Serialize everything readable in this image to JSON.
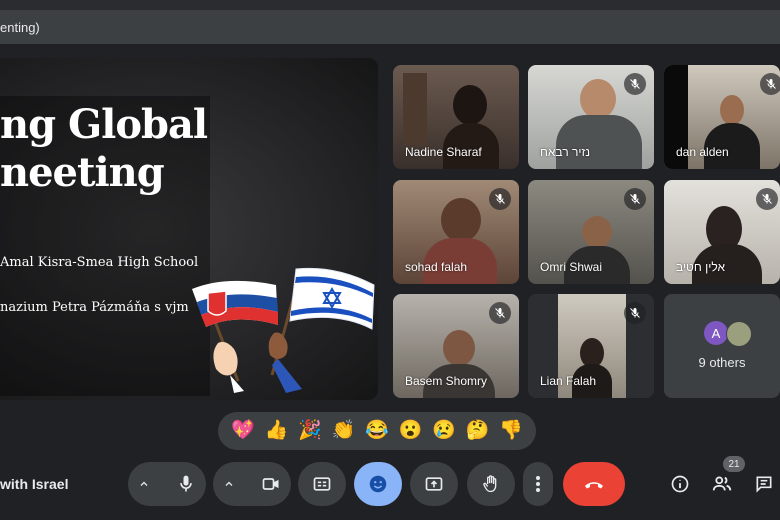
{
  "window": {
    "title": "enting)"
  },
  "presentation": {
    "title_line1": "ng Global",
    "title_line2": "neeting",
    "school1": "Amal Kisra-Smea High School",
    "school2": "nazium Petra Pázmáňa s vjm"
  },
  "tiles": [
    {
      "name": "Nadine Sharaf",
      "muted": false
    },
    {
      "name": "נזיר רבאח",
      "muted": true
    },
    {
      "name": "dan alden",
      "muted": true
    },
    {
      "name": "sohad falah",
      "muted": true
    },
    {
      "name": "Omri Shwai",
      "muted": true
    },
    {
      "name": "אלין חטיב",
      "muted": true
    },
    {
      "name": "Basem Shomry",
      "muted": true
    },
    {
      "name": "Lian Falah",
      "muted": true
    }
  ],
  "others": {
    "avatar_letter": "A",
    "label": "9 others"
  },
  "reactions": [
    "💖",
    "👍",
    "🎉",
    "👏",
    "😂",
    "😮",
    "😢",
    "🤔",
    "👎"
  ],
  "meeting": {
    "name": "with Israel"
  },
  "participants": {
    "count": "21"
  },
  "colors": {
    "end_call": "#ea4335",
    "active": "#8ab4f8",
    "control": "#3c4043"
  }
}
